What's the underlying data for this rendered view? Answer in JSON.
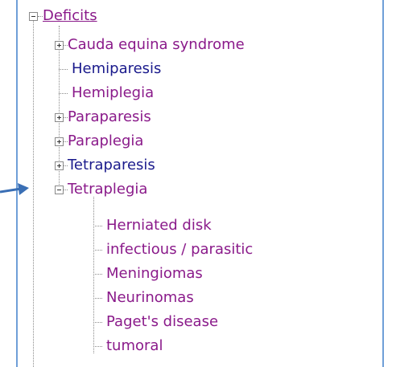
{
  "tree": {
    "root": {
      "label": "Deficits",
      "expanded": true,
      "color": "#8a1a8a"
    },
    "children": [
      {
        "label": "Cauda equina syndrome",
        "toggle": "plus"
      },
      {
        "label": "Hemiparesis",
        "toggle": "none"
      },
      {
        "label": "Hemiplegia",
        "toggle": "none"
      },
      {
        "label": "Paraparesis",
        "toggle": "plus"
      },
      {
        "label": "Paraplegia",
        "toggle": "plus"
      },
      {
        "label": "Tetraparesis",
        "toggle": "plus"
      },
      {
        "label": "Tetraplegia",
        "toggle": "minus"
      }
    ],
    "tetraplegia_children": [
      {
        "label": "Herniated disk"
      },
      {
        "label": "infectious / parasitic"
      },
      {
        "label": "Meningiomas"
      },
      {
        "label": "Neurinomas"
      },
      {
        "label": "Paget's disease"
      },
      {
        "label": "tumoral"
      }
    ]
  },
  "colors": {
    "visited": "#8a1a8a",
    "link": "#1a1a8c",
    "frame": "#6f9fd8",
    "arrow": "#3a6fb5"
  }
}
